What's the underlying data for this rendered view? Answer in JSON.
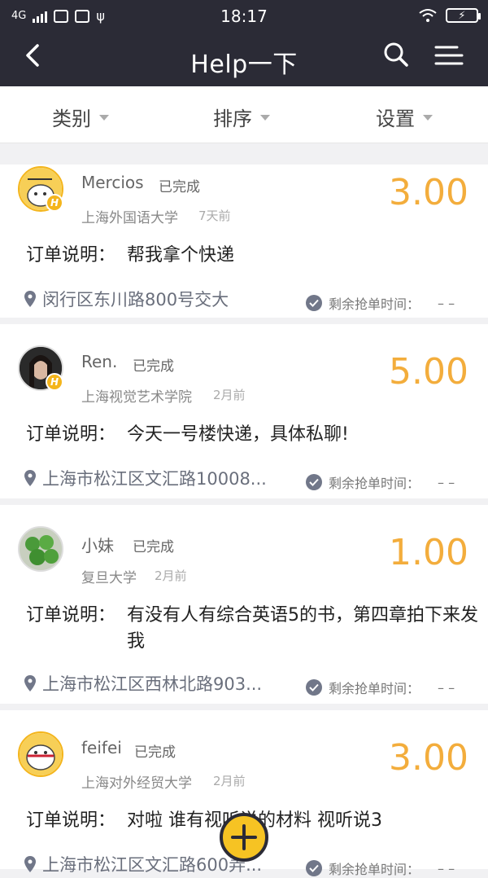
{
  "status_bar": {
    "network": "4G",
    "time": "18:17"
  },
  "nav": {
    "title": "Help一下",
    "back_icon": "chevron-left-icon",
    "search_icon": "search-icon",
    "menu_icon": "menu-icon"
  },
  "filters": [
    {
      "label": "类别"
    },
    {
      "label": "排序"
    },
    {
      "label": "设置"
    }
  ],
  "orders": [
    {
      "name": "Mercios",
      "status": "已完成",
      "school": "上海外国语大学",
      "ago": "7天前",
      "price": "3.00",
      "desc_label": "订单说明：",
      "desc": "帮我拿个快递",
      "location": "闵行区东川路800号交大",
      "timer_label": "剩余抢单时间：",
      "timer_value": "– –"
    },
    {
      "name": "Ren.",
      "status": "已完成",
      "school": "上海视觉艺术学院",
      "ago": "2月前",
      "price": "5.00",
      "desc_label": "订单说明：",
      "desc": "今天一号楼快递，具体私聊!",
      "location": "上海市松江区文汇路10008...",
      "timer_label": "剩余抢单时间：",
      "timer_value": "– –"
    },
    {
      "name": "小妹",
      "status": "已完成",
      "school": "复旦大学",
      "ago": "2月前",
      "price": "1.00",
      "desc_label": "订单说明：",
      "desc": "有没有人有综合英语5的书，第四章拍下来发我",
      "location": "上海市松江区西林北路903...",
      "timer_label": "剩余抢单时间：",
      "timer_value": "– –"
    },
    {
      "name": "feifei",
      "status": "已完成",
      "school": "上海对外经贸大学",
      "ago": "2月前",
      "price": "3.00",
      "desc_label": "订单说明：",
      "desc": "对啦 谁有视听说的材料 视听说3",
      "location": "上海市松江区文汇路600弄...",
      "timer_label": "剩余抢单时间：",
      "timer_value": "– –"
    }
  ],
  "colors": {
    "header": "#2b2b36",
    "price": "#f3ad3c",
    "badge": "#f4b51c",
    "fab": "#f6c323"
  }
}
